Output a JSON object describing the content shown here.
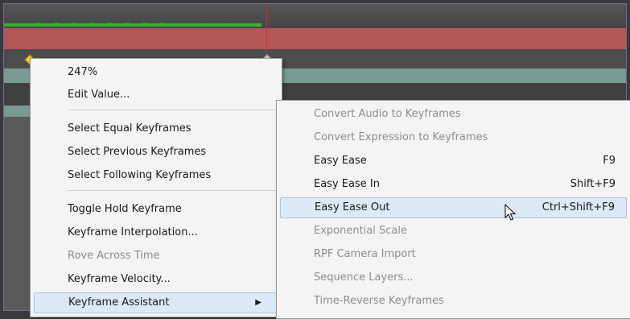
{
  "main_menu": {
    "items": [
      {
        "label": "247%",
        "disabled": false
      },
      {
        "label": "Edit Value...",
        "disabled": false
      },
      {
        "label": "Select Equal Keyframes",
        "disabled": false
      },
      {
        "label": "Select Previous Keyframes",
        "disabled": false
      },
      {
        "label": "Select Following Keyframes",
        "disabled": false
      },
      {
        "label": "Toggle Hold Keyframe",
        "disabled": false
      },
      {
        "label": "Keyframe Interpolation...",
        "disabled": false
      },
      {
        "label": "Rove Across Time",
        "disabled": true
      },
      {
        "label": "Keyframe Velocity...",
        "disabled": false
      },
      {
        "label": "Keyframe Assistant",
        "disabled": false,
        "submenu_arrow": "▶"
      }
    ]
  },
  "sub_menu": {
    "items": [
      {
        "label": "Convert Audio to Keyframes",
        "shortcut": "",
        "disabled": true
      },
      {
        "label": "Convert Expression to Keyframes",
        "shortcut": "",
        "disabled": true
      },
      {
        "label": "Easy Ease",
        "shortcut": "F9",
        "disabled": false
      },
      {
        "label": "Easy Ease In",
        "shortcut": "Shift+F9",
        "disabled": false
      },
      {
        "label": "Easy Ease Out",
        "shortcut": "Ctrl+Shift+F9",
        "disabled": false,
        "highlighted": true
      },
      {
        "label": "Exponential Scale",
        "shortcut": "",
        "disabled": true
      },
      {
        "label": "RPF Camera Import",
        "shortcut": "",
        "disabled": true
      },
      {
        "label": "Sequence Layers...",
        "shortcut": "",
        "disabled": true
      },
      {
        "label": "Time-Reverse Keyframes",
        "shortcut": "",
        "disabled": true
      }
    ]
  },
  "colors": {
    "playhead": "#e22222",
    "audio_bar": "#35b235",
    "layer_bar": "#b45757",
    "keyframe_selected": "#f2c53a",
    "menu_highlight": "#dde9f7"
  }
}
